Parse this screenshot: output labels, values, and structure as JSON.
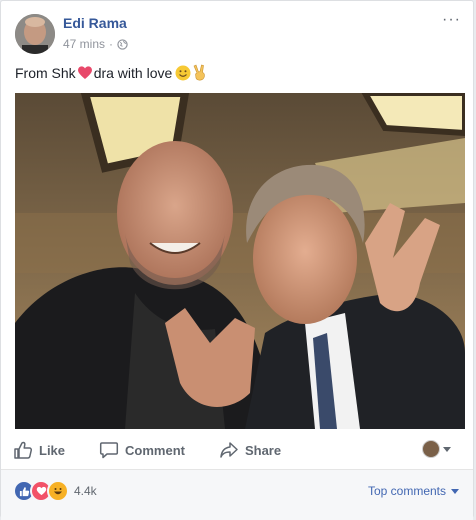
{
  "post": {
    "author": "Edi Rama",
    "time": "47 mins",
    "separator": "·",
    "text_before": "From Shk",
    "text_after": "dra with love",
    "more_label": "···"
  },
  "actions": {
    "like": "Like",
    "comment": "Comment",
    "share": "Share"
  },
  "footer": {
    "reaction_count": "4.4k",
    "top_comments": "Top comments"
  },
  "colors": {
    "author_link": "#365899",
    "action_text": "#606770",
    "like_blue": "#4267b2",
    "love_red": "#f25268",
    "haha_yellow": "#f7b125"
  },
  "icons": [
    "globe-icon",
    "heart-emoji",
    "smile-emoji",
    "victory-hand-emoji",
    "like-icon",
    "comment-icon",
    "share-icon",
    "like-reaction-icon",
    "love-reaction-icon",
    "haha-reaction-icon"
  ]
}
